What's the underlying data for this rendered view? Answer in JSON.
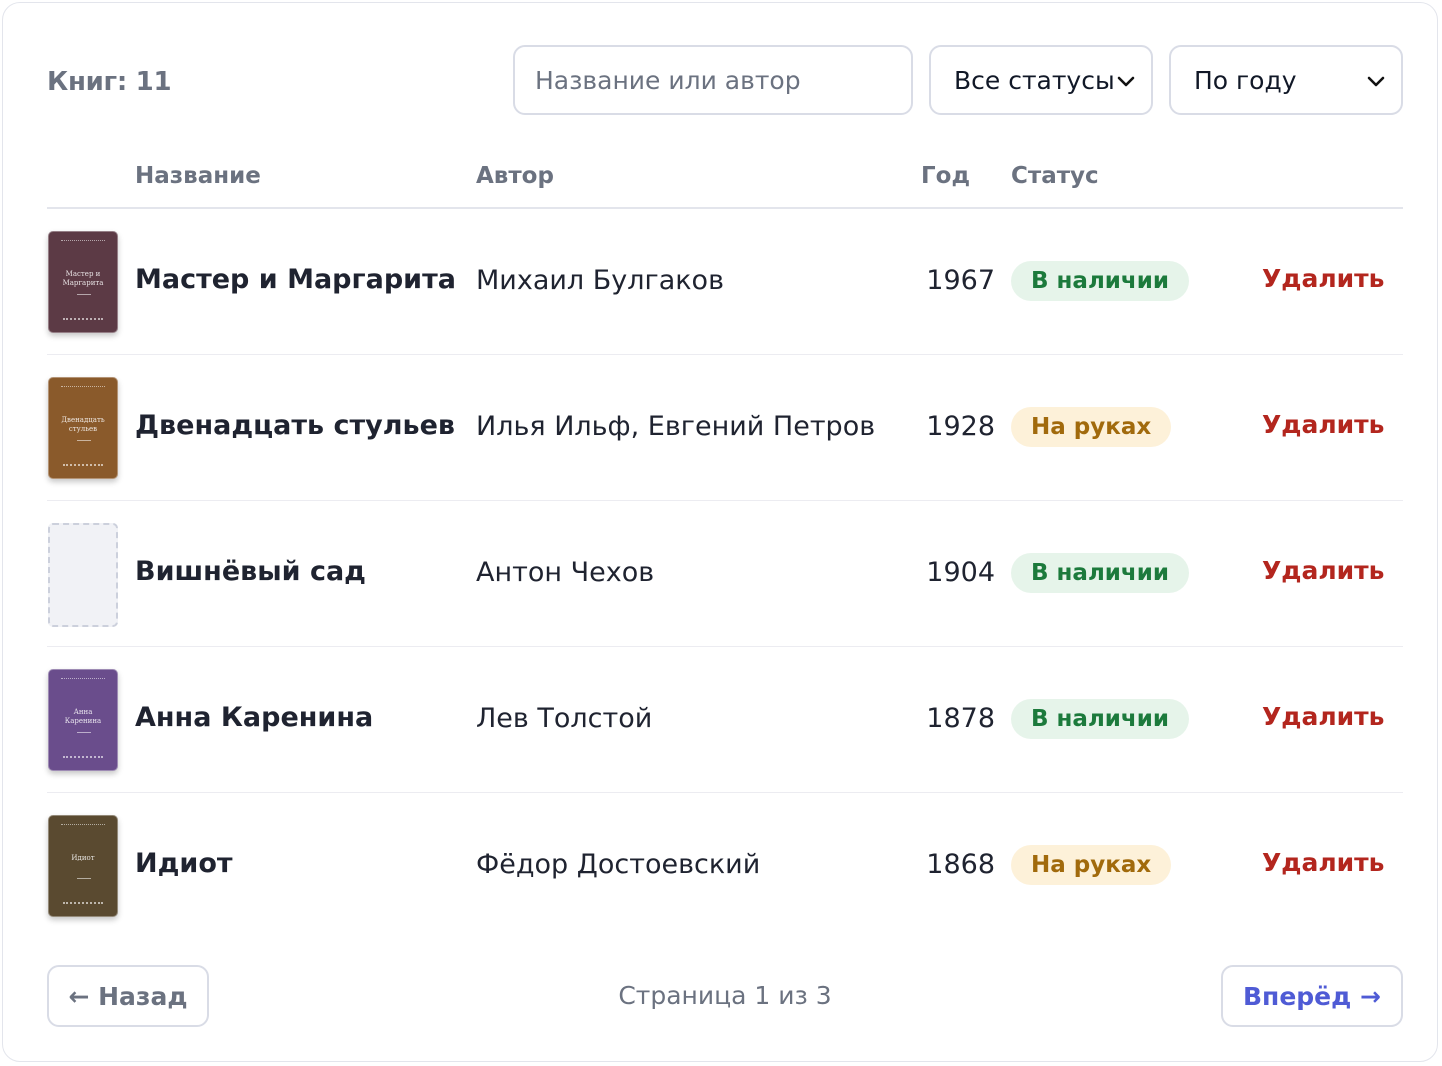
{
  "toolbar": {
    "count_label": "Книг: 11",
    "search_placeholder": "Название или автор",
    "search_value": "",
    "status_filter": "Все статусы",
    "sort_by": "По году"
  },
  "table": {
    "columns": [
      "Название",
      "Автор",
      "Год",
      "Статус"
    ],
    "delete_label": "Удалить",
    "rows": [
      {
        "title": "Мастер и Маргарита",
        "author": "Михаил Булгаков",
        "year": "1967",
        "status": "В наличии",
        "status_kind": "available",
        "cover_color": "#5c3a45",
        "cover_text": "Мастер и Маргарита"
      },
      {
        "title": "Двенадцать стульев",
        "author": "Илья Ильф, Евгений Петров",
        "year": "1928",
        "status": "На руках",
        "status_kind": "borrowed",
        "cover_color": "#8a5a2b",
        "cover_text": "Двенадцать стульев"
      },
      {
        "title": "Вишнёвый сад",
        "author": "Антон Чехов",
        "year": "1904",
        "status": "В наличии",
        "status_kind": "available",
        "cover_color": "",
        "cover_text": ""
      },
      {
        "title": "Анна Каренина",
        "author": "Лев Толстой",
        "year": "1878",
        "status": "В наличии",
        "status_kind": "available",
        "cover_color": "#6a4d8c",
        "cover_text": "Анна Каренина"
      },
      {
        "title": "Идиот",
        "author": "Фёдор Достоевский",
        "year": "1868",
        "status": "На руках",
        "status_kind": "borrowed",
        "cover_color": "#5a4a30",
        "cover_text": "Идиот"
      }
    ]
  },
  "pagination": {
    "prev_label": "← Назад",
    "next_label": "Вперёд →",
    "page_info": "Страница 1 из 3"
  },
  "colors": {
    "accent": "#4f5bd5",
    "danger": "#b3261e",
    "available_bg": "#e6f4ea",
    "available_fg": "#1c7a3c",
    "borrowed_bg": "#fdf1d9",
    "borrowed_fg": "#a16a0c"
  }
}
